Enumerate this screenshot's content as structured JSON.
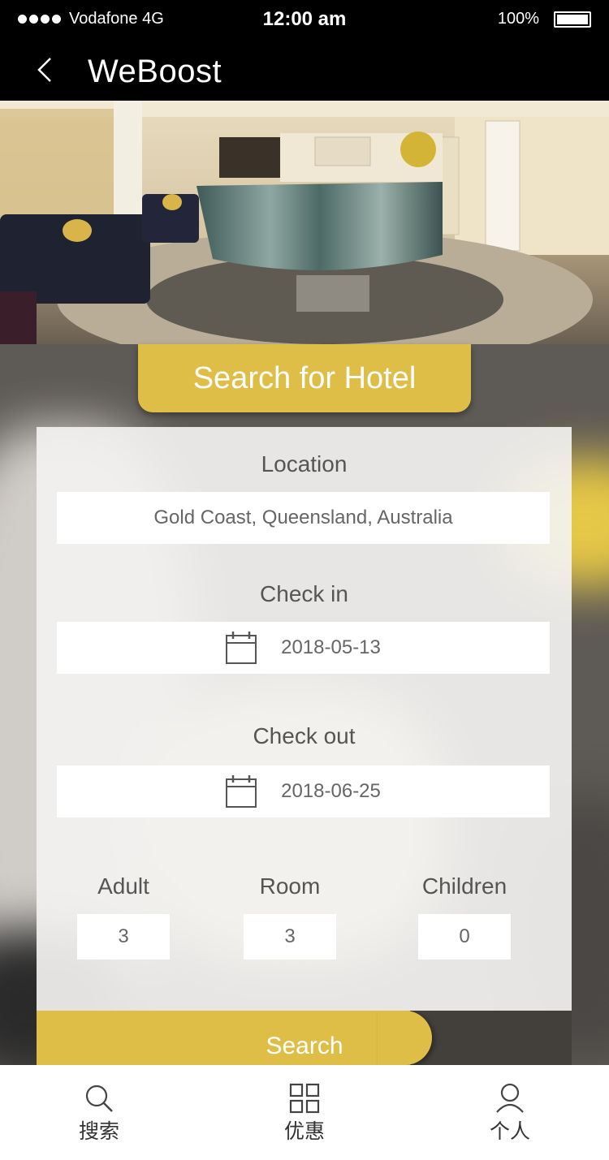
{
  "status_bar": {
    "carrier": "Vodafone 4G",
    "time": "12:00 am",
    "battery": "100%"
  },
  "nav": {
    "title": "WeBoost"
  },
  "search_tab": {
    "label": "Search for Hotel"
  },
  "form": {
    "location_label": "Location",
    "location_value": "Gold Coast, Queensland, Australia",
    "checkin_label": "Check in",
    "checkin_value": "2018-05-13",
    "checkout_label": "Check out",
    "checkout_value": "2018-06-25",
    "adult_label": "Adult",
    "adult_value": "3",
    "room_label": "Room",
    "room_value": "3",
    "children_label": "Children",
    "children_value": "0",
    "search_label": "Search"
  },
  "tab_bar": {
    "items": [
      {
        "label": "搜索",
        "icon": "search-icon"
      },
      {
        "label": "优惠",
        "icon": "grid-icon"
      },
      {
        "label": "个人",
        "icon": "user-icon"
      }
    ]
  },
  "colors": {
    "accent": "#dfbe47",
    "dark": "#433f3b",
    "card": "#f3f2f1"
  }
}
